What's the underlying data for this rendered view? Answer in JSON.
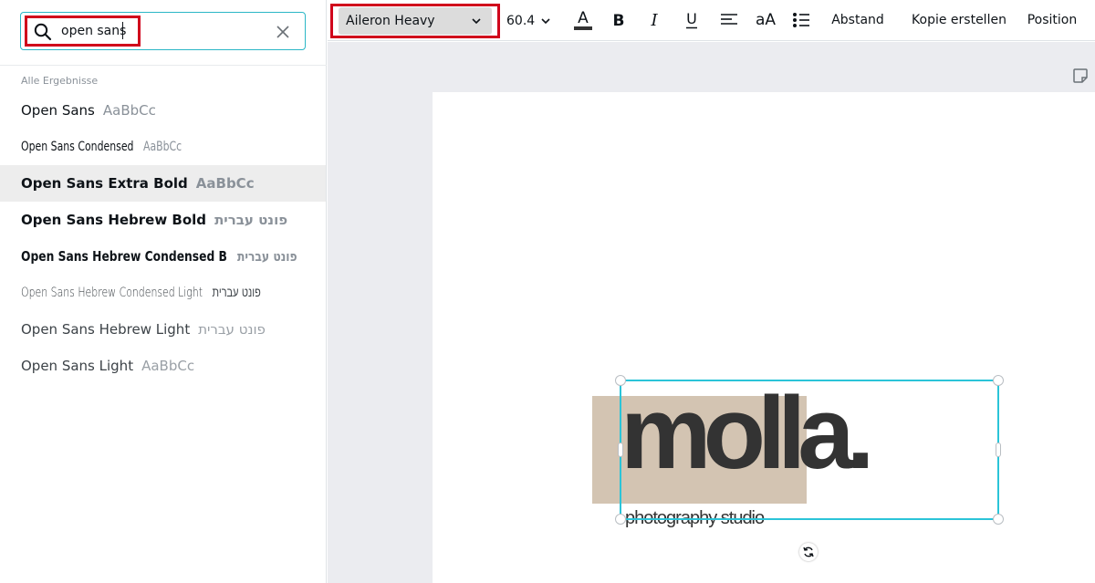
{
  "search": {
    "value": "open sans",
    "results_label": "Alle Ergebnisse"
  },
  "font_results": [
    {
      "name": "Open Sans",
      "preview": "AaBbCc"
    },
    {
      "name": "Open Sans Condensed",
      "preview": "AaBbCc"
    },
    {
      "name": "Open Sans Extra Bold",
      "preview": "AaBbCc"
    },
    {
      "name": "Open Sans Hebrew Bold",
      "preview": "פונט עברית"
    },
    {
      "name": "Open Sans Hebrew Condensed B",
      "preview": "פונט עברית"
    },
    {
      "name": "Open Sans Hebrew Condensed Light",
      "preview": "פונט עברית"
    },
    {
      "name": "Open Sans Hebrew Light",
      "preview": "פונט עברית"
    },
    {
      "name": "Open Sans Light",
      "preview": "AaBbCc"
    }
  ],
  "toolbar": {
    "font_family": "Aileron Heavy",
    "font_size": "60.4",
    "case_label": "aA",
    "spacing_label": "Abstand",
    "copy_label": "Kopie erstellen",
    "position_label": "Position"
  },
  "canvas": {
    "logo_text": "molla.",
    "logo_subtitle": "photography studio"
  },
  "colors": {
    "accent_cyan": "#2bc4d8",
    "highlight_red": "#d0021b",
    "logo_beige": "#d3c4b2",
    "logo_text": "#333333"
  },
  "icons": [
    "search-icon",
    "clear-icon",
    "chevron-down-icon",
    "text-color-icon",
    "bold-icon",
    "italic-icon",
    "underline-icon",
    "align-left-icon",
    "list-icon",
    "note-icon",
    "rotate-icon"
  ]
}
